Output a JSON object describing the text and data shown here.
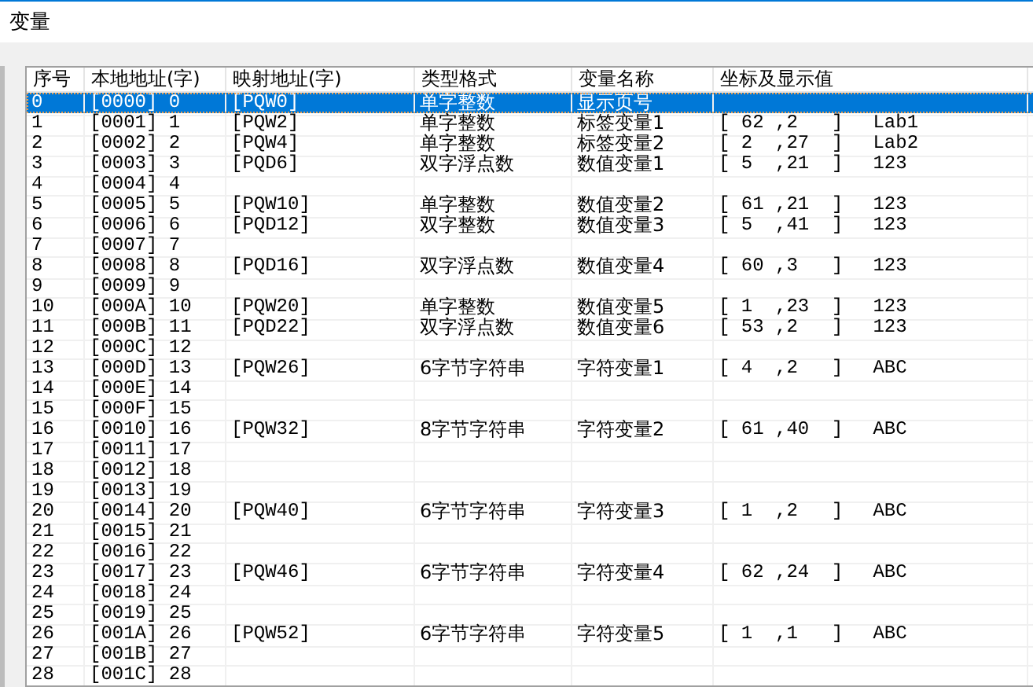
{
  "window": {
    "title": "变量"
  },
  "table": {
    "columns": [
      "序号",
      "本地地址(字)",
      "映射地址(字)",
      "类型格式",
      "变量名称",
      "坐标及显示值"
    ],
    "rows": [
      {
        "index": "0",
        "local": "[0000] 0",
        "mapped": "[PQW0]",
        "type": "单字整数",
        "name": "显示页号",
        "selected": true
      },
      {
        "index": "1",
        "local": "[0001] 1",
        "mapped": "[PQW2]",
        "type": "单字整数",
        "name": "标签变量1",
        "coord": "[ 62 ,2   ]",
        "value": "Lab1",
        "selected": false
      },
      {
        "index": "2",
        "local": "[0002] 2",
        "mapped": "[PQW4]",
        "type": "单字整数",
        "name": "标签变量2",
        "coord": "[ 2  ,27  ]",
        "value": "Lab2",
        "selected": false
      },
      {
        "index": "3",
        "local": "[0003] 3",
        "mapped": "[PQD6]",
        "type": "双字浮点数",
        "name": "数值变量1",
        "coord": "[ 5  ,21  ]",
        "value": "123",
        "selected": false
      },
      {
        "index": "4",
        "local": "[0004] 4",
        "selected": false
      },
      {
        "index": "5",
        "local": "[0005] 5",
        "mapped": "[PQW10]",
        "type": "单字整数",
        "name": "数值变量2",
        "coord": "[ 61 ,21  ]",
        "value": "123",
        "selected": false
      },
      {
        "index": "6",
        "local": "[0006] 6",
        "mapped": "[PQD12]",
        "type": "双字整数",
        "name": "数值变量3",
        "coord": "[ 5  ,41  ]",
        "value": "123",
        "selected": false
      },
      {
        "index": "7",
        "local": "[0007] 7",
        "selected": false
      },
      {
        "index": "8",
        "local": "[0008] 8",
        "mapped": "[PQD16]",
        "type": "双字浮点数",
        "name": "数值变量4",
        "coord": "[ 60 ,3   ]",
        "value": "123",
        "selected": false
      },
      {
        "index": "9",
        "local": "[0009] 9",
        "selected": false
      },
      {
        "index": "10",
        "local": "[000A] 10",
        "mapped": "[PQW20]",
        "type": "单字整数",
        "name": "数值变量5",
        "coord": "[ 1  ,23  ]",
        "value": "123",
        "selected": false
      },
      {
        "index": "11",
        "local": "[000B] 11",
        "mapped": "[PQD22]",
        "type": "双字浮点数",
        "name": "数值变量6",
        "coord": "[ 53 ,2   ]",
        "value": "123",
        "selected": false
      },
      {
        "index": "12",
        "local": "[000C] 12",
        "selected": false
      },
      {
        "index": "13",
        "local": "[000D] 13",
        "mapped": "[PQW26]",
        "type": "6字节字符串",
        "name": "字符变量1",
        "coord": "[ 4  ,2   ]",
        "value": "ABC",
        "selected": false
      },
      {
        "index": "14",
        "local": "[000E] 14",
        "selected": false
      },
      {
        "index": "15",
        "local": "[000F] 15",
        "selected": false
      },
      {
        "index": "16",
        "local": "[0010] 16",
        "mapped": "[PQW32]",
        "type": "8字节字符串",
        "name": "字符变量2",
        "coord": "[ 61 ,40  ]",
        "value": "ABC",
        "selected": false
      },
      {
        "index": "17",
        "local": "[0011] 17",
        "selected": false
      },
      {
        "index": "18",
        "local": "[0012] 18",
        "selected": false
      },
      {
        "index": "19",
        "local": "[0013] 19",
        "selected": false
      },
      {
        "index": "20",
        "local": "[0014] 20",
        "mapped": "[PQW40]",
        "type": "6字节字符串",
        "name": "字符变量3",
        "coord": "[ 1  ,2   ]",
        "value": "ABC",
        "selected": false
      },
      {
        "index": "21",
        "local": "[0015] 21",
        "selected": false
      },
      {
        "index": "22",
        "local": "[0016] 22",
        "selected": false
      },
      {
        "index": "23",
        "local": "[0017] 23",
        "mapped": "[PQW46]",
        "type": "6字节字符串",
        "name": "字符变量4",
        "coord": "[ 62 ,24  ]",
        "value": "ABC",
        "selected": false
      },
      {
        "index": "24",
        "local": "[0018] 24",
        "selected": false
      },
      {
        "index": "25",
        "local": "[0019] 25",
        "selected": false
      },
      {
        "index": "26",
        "local": "[001A] 26",
        "mapped": "[PQW52]",
        "type": "6字节字符串",
        "name": "字符变量5",
        "coord": "[ 1  ,1   ]",
        "value": "ABC",
        "selected": false
      },
      {
        "index": "27",
        "local": "[001B] 27",
        "selected": false
      },
      {
        "index": "28",
        "local": "[001C] 28",
        "selected": false
      }
    ]
  }
}
